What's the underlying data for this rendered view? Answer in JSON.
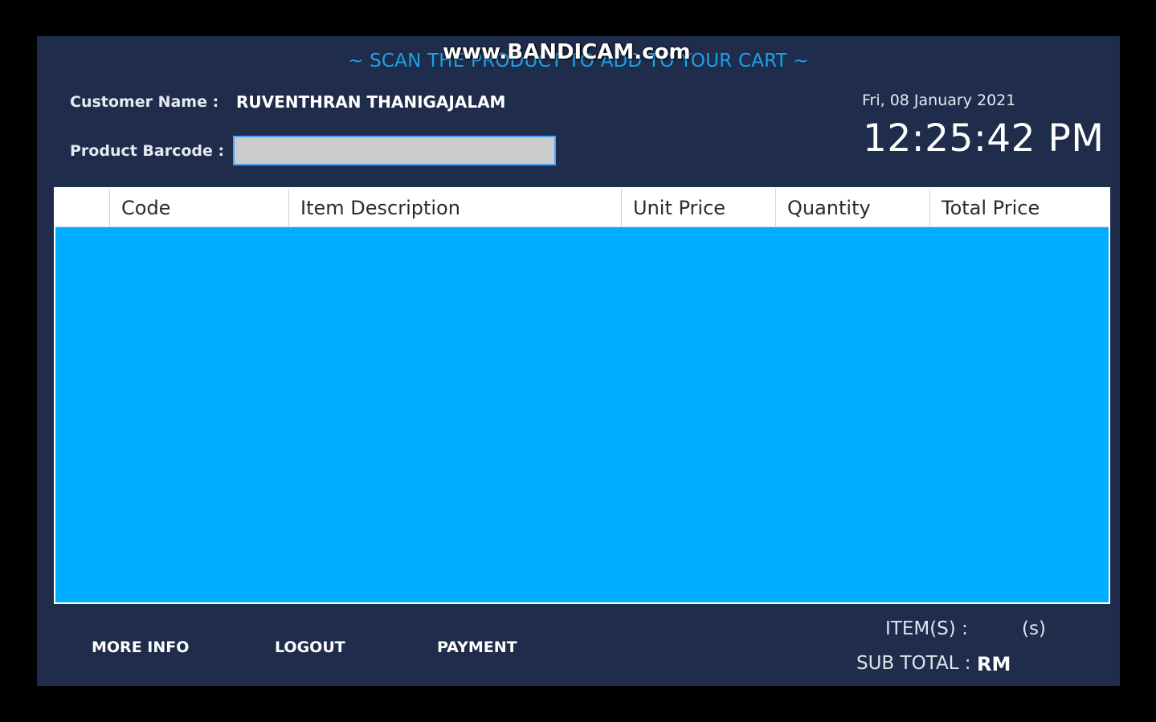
{
  "banner": {
    "scan_text": "~ SCAN THE PRODUCT TO ADD TO YOUR CART ~",
    "watermark": "www.BANDICAM.com"
  },
  "customer": {
    "label": "Customer Name :",
    "name": "RUVENTHRAN THANIGAJALAM"
  },
  "barcode": {
    "label": "Product Barcode :",
    "value": "",
    "placeholder": ""
  },
  "datetime": {
    "date": "Fri, 08 January 2021",
    "time": "12:25:42 PM"
  },
  "cart_table": {
    "columns": [
      "",
      "Code",
      "Item Description",
      "Unit Price",
      "Quantity",
      "Total Price"
    ],
    "rows": []
  },
  "buttons": {
    "more_info": "MORE INFO",
    "logout": "LOGOUT",
    "payment": "PAYMENT"
  },
  "summary": {
    "items_label": "ITEM(S) :",
    "items_count": "",
    "items_suffix": "(s)",
    "subtotal_label": "SUB TOTAL :",
    "subtotal_currency": "RM",
    "subtotal_value": ""
  },
  "colors": {
    "app_background": "#1f2c4b",
    "grid_background": "#00aeff",
    "banner_text": "#1aa3e6"
  }
}
